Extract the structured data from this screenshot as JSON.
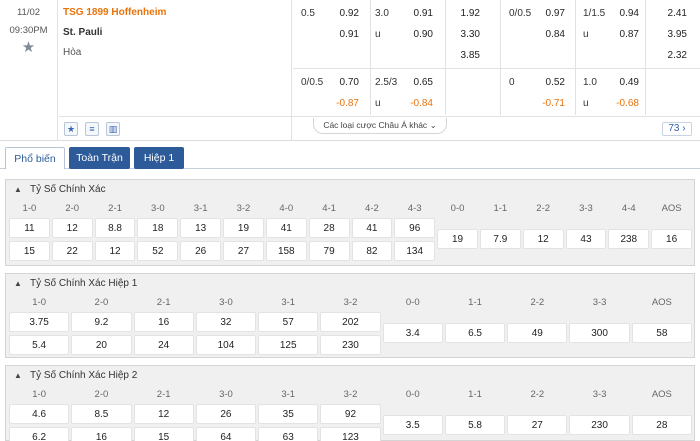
{
  "match": {
    "date": "11/02",
    "time": "09:30PM",
    "home_team": "TSG 1899 Hoffenheim",
    "away_team": "St. Pauli",
    "draw_label": "Hòa",
    "rows": [
      [
        {
          "t": "0.5",
          "k": "lbl"
        },
        {
          "t": "0.92",
          "k": "val"
        },
        {
          "t": "3.0",
          "k": "lbl"
        },
        {
          "t": "0.91",
          "k": "val"
        },
        {
          "t": "1.92",
          "k": "val"
        },
        {
          "t": "0/0.5",
          "k": "lbl"
        },
        {
          "t": "0.97",
          "k": "val"
        },
        {
          "t": "1/1.5",
          "k": "lbl"
        },
        {
          "t": "0.94",
          "k": "val"
        },
        {
          "t": "2.41",
          "k": "val"
        }
      ],
      [
        {
          "t": "",
          "k": "lbl"
        },
        {
          "t": "0.91",
          "k": "val"
        },
        {
          "t": "u",
          "k": "lbl"
        },
        {
          "t": "0.90",
          "k": "val"
        },
        {
          "t": "3.30",
          "k": "val"
        },
        {
          "t": "",
          "k": "lbl"
        },
        {
          "t": "0.84",
          "k": "val"
        },
        {
          "t": "u",
          "k": "lbl"
        },
        {
          "t": "0.87",
          "k": "val"
        },
        {
          "t": "3.95",
          "k": "val"
        }
      ],
      [
        {
          "t": "",
          "k": "lbl"
        },
        {
          "t": "",
          "k": "val"
        },
        {
          "t": "",
          "k": "lbl"
        },
        {
          "t": "",
          "k": "val"
        },
        {
          "t": "3.85",
          "k": "val"
        },
        {
          "t": "",
          "k": "lbl"
        },
        {
          "t": "",
          "k": "val"
        },
        {
          "t": "",
          "k": "lbl"
        },
        {
          "t": "",
          "k": "val"
        },
        {
          "t": "2.32",
          "k": "val"
        }
      ],
      [
        {
          "t": "0/0.5",
          "k": "lbl"
        },
        {
          "t": "0.70",
          "k": "val"
        },
        {
          "t": "2.5/3",
          "k": "lbl"
        },
        {
          "t": "0.65",
          "k": "val"
        },
        {
          "t": "",
          "k": "val"
        },
        {
          "t": "0",
          "k": "lbl"
        },
        {
          "t": "0.52",
          "k": "val"
        },
        {
          "t": "1.0",
          "k": "lbl"
        },
        {
          "t": "0.49",
          "k": "val"
        },
        {
          "t": "",
          "k": "val"
        }
      ],
      [
        {
          "t": "",
          "k": "lbl"
        },
        {
          "t": "-0.87",
          "k": "neg"
        },
        {
          "t": "u",
          "k": "lbl"
        },
        {
          "t": "-0.84",
          "k": "neg"
        },
        {
          "t": "",
          "k": "val"
        },
        {
          "t": "",
          "k": "lbl"
        },
        {
          "t": "-0.71",
          "k": "neg"
        },
        {
          "t": "u",
          "k": "lbl"
        },
        {
          "t": "-0.68",
          "k": "neg"
        },
        {
          "t": "",
          "k": "val"
        }
      ]
    ],
    "more_bets_label": "Các loại cược Châu Á khác",
    "market_count": "73"
  },
  "icons": [
    "star-icon",
    "list-icon",
    "stats-icon",
    "chevron-down-icon"
  ],
  "tabs": [
    {
      "label": "Phổ biến",
      "active": true
    },
    {
      "label": "Toàn Trận",
      "active": false
    },
    {
      "label": "Hiệp 1",
      "active": false
    }
  ],
  "markets": [
    {
      "title": "Tỷ Số Chính Xác",
      "groups": [
        {
          "label": "1-0",
          "values": [
            "11",
            "15"
          ]
        },
        {
          "label": "2-0",
          "values": [
            "12",
            "22"
          ]
        },
        {
          "label": "2-1",
          "values": [
            "8.8",
            "12"
          ]
        },
        {
          "label": "3-0",
          "values": [
            "18",
            "52"
          ]
        },
        {
          "label": "3-1",
          "values": [
            "13",
            "26"
          ]
        },
        {
          "label": "3-2",
          "values": [
            "19",
            "27"
          ]
        },
        {
          "label": "4-0",
          "values": [
            "41",
            "158"
          ]
        },
        {
          "label": "4-1",
          "values": [
            "28",
            "79"
          ]
        },
        {
          "label": "4-2",
          "values": [
            "41",
            "82"
          ]
        },
        {
          "label": "4-3",
          "values": [
            "96",
            "134"
          ]
        }
      ],
      "draws": [
        {
          "label": "0-0",
          "value": "19"
        },
        {
          "label": "1-1",
          "value": "7.9"
        },
        {
          "label": "2-2",
          "value": "12"
        },
        {
          "label": "3-3",
          "value": "43"
        },
        {
          "label": "4-4",
          "value": "238"
        },
        {
          "label": "AOS",
          "value": "16"
        }
      ]
    },
    {
      "title": "Tỷ Số Chính Xác Hiệp 1",
      "groups": [
        {
          "label": "1-0",
          "values": [
            "3.75",
            "5.4"
          ]
        },
        {
          "label": "2-0",
          "values": [
            "9.2",
            "20"
          ]
        },
        {
          "label": "2-1",
          "values": [
            "16",
            "24"
          ]
        },
        {
          "label": "3-0",
          "values": [
            "32",
            "104"
          ]
        },
        {
          "label": "3-1",
          "values": [
            "57",
            "125"
          ]
        },
        {
          "label": "3-2",
          "values": [
            "202",
            "230"
          ]
        }
      ],
      "draws": [
        {
          "label": "0-0",
          "value": "3.4"
        },
        {
          "label": "1-1",
          "value": "6.5"
        },
        {
          "label": "2-2",
          "value": "49"
        },
        {
          "label": "3-3",
          "value": "300"
        },
        {
          "label": "AOS",
          "value": "58"
        }
      ]
    },
    {
      "title": "Tỷ Số Chính Xác Hiệp 2",
      "groups": [
        {
          "label": "1-0",
          "values": [
            "4.6",
            "6.2"
          ]
        },
        {
          "label": "2-0",
          "values": [
            "8.5",
            "16"
          ]
        },
        {
          "label": "2-1",
          "values": [
            "12",
            "15"
          ]
        },
        {
          "label": "3-0",
          "values": [
            "26",
            "64"
          ]
        },
        {
          "label": "3-1",
          "values": [
            "35",
            "63"
          ]
        },
        {
          "label": "3-2",
          "values": [
            "92",
            "123"
          ]
        }
      ],
      "draws": [
        {
          "label": "0-0",
          "value": "3.5"
        },
        {
          "label": "1-1",
          "value": "5.8"
        },
        {
          "label": "2-2",
          "value": "27"
        },
        {
          "label": "3-3",
          "value": "230"
        },
        {
          "label": "AOS",
          "value": "28"
        }
      ]
    }
  ],
  "colors": {
    "accent_orange": "#e8730c",
    "tab_blue": "#2d5b9a",
    "panel_grey": "#f0f0f0"
  }
}
